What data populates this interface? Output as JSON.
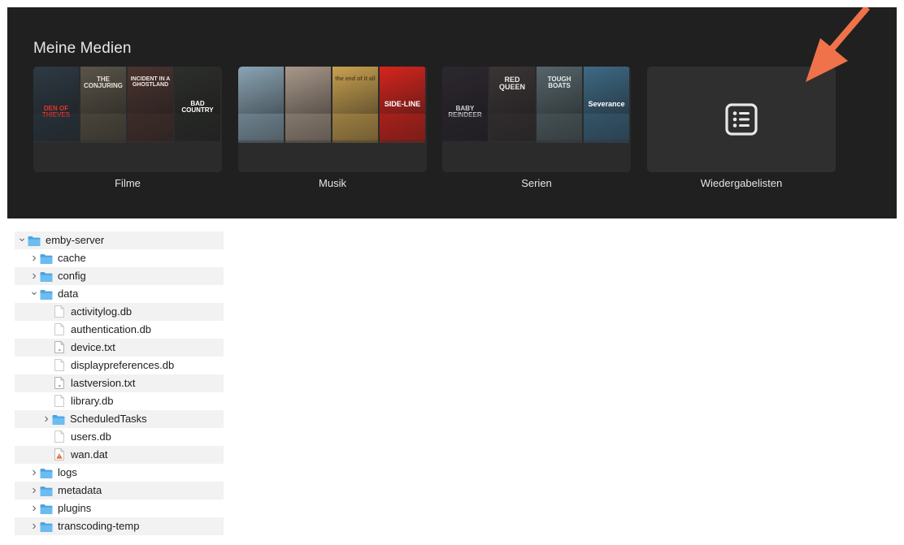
{
  "media_panel": {
    "title": "Meine Medien",
    "libraries": [
      {
        "label": "Filme",
        "posters": [
          {
            "text": "DEN OF THIEVES",
            "bg": "#2e3a44",
            "fg": "#e8332a"
          },
          {
            "text": "THE CONJURING",
            "bg": "#5a5448",
            "fg": "#e9e4d8"
          },
          {
            "text": "INCIDENT IN A GHOSTLAND",
            "bg": "#4a3430",
            "fg": "#f2e8df"
          },
          {
            "text": "BAD COUNTRY",
            "bg": "#2d2f2c",
            "fg": "#ffffff"
          }
        ]
      },
      {
        "label": "Musik",
        "posters": [
          {
            "text": "",
            "bg": "#8aa4b4",
            "fg": "#ffffff"
          },
          {
            "text": "",
            "bg": "#a9988a",
            "fg": "#ffffff"
          },
          {
            "text": "the end of it all",
            "bg": "#c9a150",
            "fg": "#5a4420"
          },
          {
            "text": "SIDE-LINE",
            "bg": "#d7241d",
            "fg": "#ffffff"
          }
        ]
      },
      {
        "label": "Serien",
        "posters": [
          {
            "text": "BABY REINDEER",
            "bg": "#2d2830",
            "fg": "#d4d0d6"
          },
          {
            "text": "RED QUEEN",
            "bg": "#3b3536",
            "fg": "#f0ece8"
          },
          {
            "text": "TOUGH BOATS",
            "bg": "#55656a",
            "fg": "#e8eef0"
          },
          {
            "text": "Severance",
            "bg": "#3e6a85",
            "fg": "#ffffff"
          }
        ]
      },
      {
        "label": "Wiedergabelisten",
        "posters": []
      }
    ]
  },
  "file_tree": [
    {
      "name": "emby-server",
      "type": "folder",
      "level": 0,
      "expanded": true
    },
    {
      "name": "cache",
      "type": "folder",
      "level": 1,
      "expanded": false
    },
    {
      "name": "config",
      "type": "folder",
      "level": 1,
      "expanded": false
    },
    {
      "name": "data",
      "type": "folder",
      "level": 1,
      "expanded": true
    },
    {
      "name": "activitylog.db",
      "type": "file",
      "level": 2
    },
    {
      "name": "authentication.db",
      "type": "file",
      "level": 2
    },
    {
      "name": "device.txt",
      "type": "text",
      "level": 2
    },
    {
      "name": "displaypreferences.db",
      "type": "file",
      "level": 2
    },
    {
      "name": "lastversion.txt",
      "type": "text",
      "level": 2
    },
    {
      "name": "library.db",
      "type": "file",
      "level": 2
    },
    {
      "name": "ScheduledTasks",
      "type": "folder",
      "level": 2,
      "expanded": false
    },
    {
      "name": "users.db",
      "type": "file",
      "level": 2
    },
    {
      "name": "wan.dat",
      "type": "warning",
      "level": 2
    },
    {
      "name": "logs",
      "type": "folder",
      "level": 1,
      "expanded": false
    },
    {
      "name": "metadata",
      "type": "folder",
      "level": 1,
      "expanded": false
    },
    {
      "name": "plugins",
      "type": "folder",
      "level": 1,
      "expanded": false
    },
    {
      "name": "transcoding-temp",
      "type": "folder",
      "level": 1,
      "expanded": false
    }
  ],
  "colors": {
    "panel_bg": "#202020",
    "tile_bg": "#2b2b2b",
    "folder_blue": "#5aaee8",
    "arrow": "#f0724a"
  }
}
